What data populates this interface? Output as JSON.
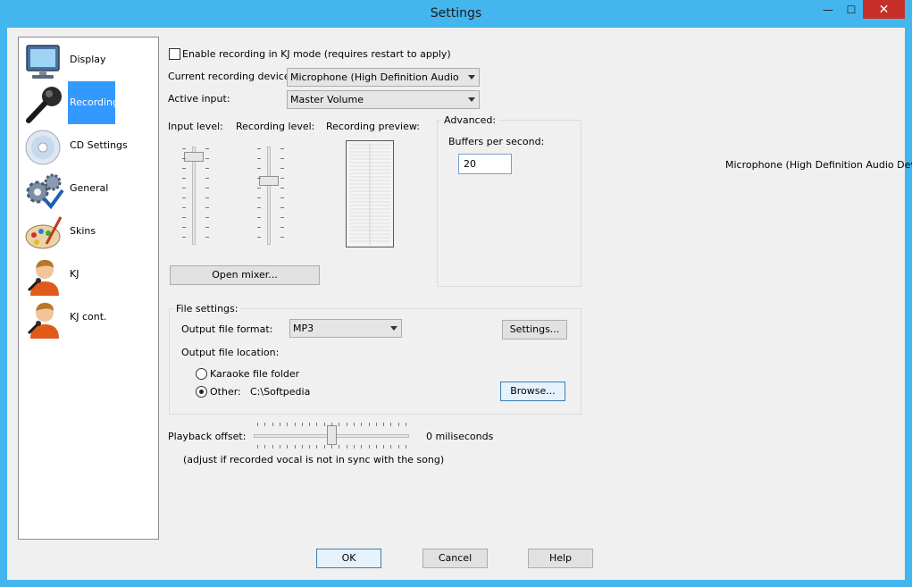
{
  "window": {
    "title": "Settings",
    "minimize": "—",
    "maximize": "☐",
    "close": "✕"
  },
  "sidebar": {
    "items": [
      {
        "label": "Display",
        "icon": "monitor-icon"
      },
      {
        "label": "Recording",
        "icon": "microphone-icon",
        "selected": true
      },
      {
        "label": "CD Settings",
        "icon": "cd-icon"
      },
      {
        "label": "General",
        "icon": "gears-icon"
      },
      {
        "label": "Skins",
        "icon": "palette-icon"
      },
      {
        "label": "KJ",
        "icon": "singer-icon"
      },
      {
        "label": "KJ cont.",
        "icon": "singer-icon"
      }
    ]
  },
  "recording": {
    "kj_mode_label": "Enable recording in KJ mode (requires restart to apply)",
    "kj_mode_checked": false,
    "device_label": "Current recording device:",
    "device_value": "Microphone (High Definition Audio Device)",
    "input_label": "Active input:",
    "input_value": "Master Volume",
    "input_level_label": "Input level:",
    "recording_level_label": "Recording level:",
    "preview_label": "Recording preview:",
    "input_level": 0.92,
    "recording_level": 0.65,
    "open_mixer_label": "Open mixer...",
    "advanced_label": "Advanced:",
    "buffers_label": "Buffers per second:",
    "buffers_value": "20",
    "device_readout": "Microphone (High Definition Audio Devic"
  },
  "file_settings": {
    "group_label": "File settings:",
    "format_label": "Output file format:",
    "format_value": "MP3",
    "settings_button": "Settings...",
    "location_label": "Output file location:",
    "karaoke_folder_label": "Karaoke file folder",
    "other_label": "Other:",
    "other_path": "C:\\Softpedia",
    "browse_button": "Browse...",
    "selected_location": "other"
  },
  "playback": {
    "offset_label": "Playback offset:",
    "offset_value": "0 miliseconds",
    "offset_position": 0.5,
    "hint": "(adjust if recorded vocal is not in sync with the song)"
  },
  "footer": {
    "ok": "OK",
    "cancel": "Cancel",
    "help": "Help"
  }
}
